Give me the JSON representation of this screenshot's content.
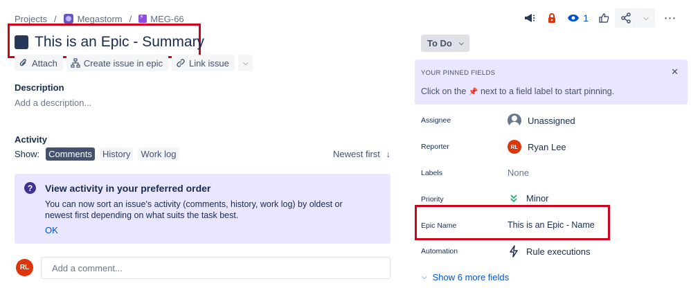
{
  "breadcrumb": {
    "root": "Projects",
    "project": "Megastorm",
    "issue_key": "MEG-66"
  },
  "header_actions": {
    "watch_count": "1"
  },
  "issue": {
    "title": "This is an Epic - Summary"
  },
  "actions": {
    "attach": "Attach",
    "create_in_epic": "Create issue in epic",
    "link_issue": "Link issue"
  },
  "description": {
    "heading": "Description",
    "placeholder": "Add a description..."
  },
  "activity": {
    "heading": "Activity",
    "show_label": "Show:",
    "tabs": [
      "Comments",
      "History",
      "Work log"
    ],
    "sort": "Newest first",
    "info_title": "View activity in your preferred order",
    "info_body": "You can now sort an issue's activity (comments, history, work log) by oldest or newest first depending on what suits the task best.",
    "info_ok": "OK",
    "user_initials": "RL",
    "comment_placeholder": "Add a comment..."
  },
  "sidebar": {
    "status": "To Do",
    "pinned_heading": "YOUR PINNED FIELDS",
    "pinned_text_before": "Click on the",
    "pinned_text_after": "next to a field label to start pinning.",
    "fields": {
      "assignee_label": "Assignee",
      "assignee_value": "Unassigned",
      "reporter_label": "Reporter",
      "reporter_initials": "RL",
      "reporter_value": "Ryan Lee",
      "labels_label": "Labels",
      "labels_value": "None",
      "priority_label": "Priority",
      "priority_value": "Minor",
      "epic_name_label": "Epic Name",
      "epic_name_value": "This is an Epic - Name",
      "automation_label": "Automation",
      "automation_value": "Rule executions"
    },
    "show_more": "Show 6 more fields"
  },
  "colors": {
    "annotation_red": "#d0021b",
    "link_blue": "#0052cc",
    "info_purple": "#eae6ff",
    "avatar_red": "#de350b"
  },
  "icons": [
    "megaphone-icon",
    "lock-icon",
    "eye-icon",
    "thumbs-up-icon",
    "share-icon",
    "chevron-down-icon",
    "more-icon",
    "paperclip-icon",
    "hierarchy-icon",
    "link-icon",
    "question-icon",
    "pin-icon",
    "close-icon",
    "priority-minor-icon",
    "lightning-icon"
  ]
}
